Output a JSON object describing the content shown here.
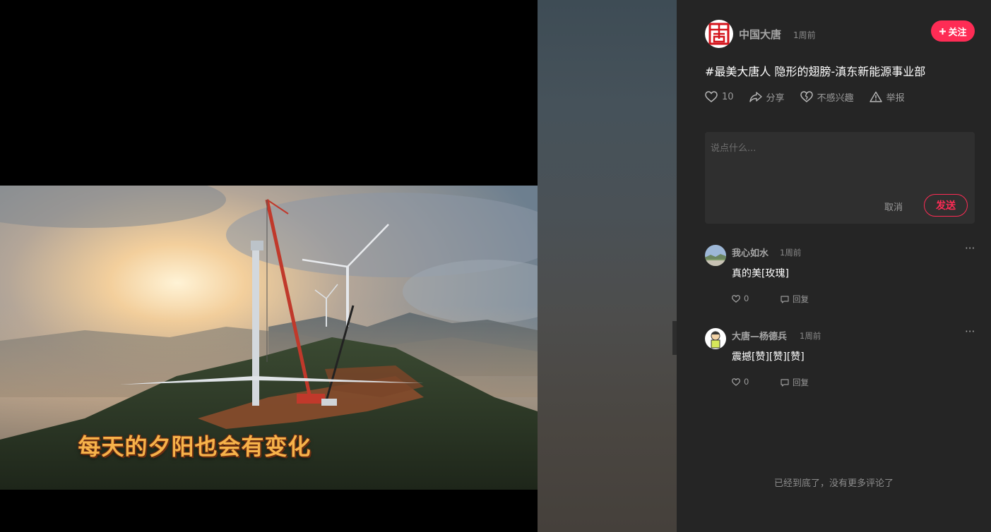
{
  "video": {
    "subtitle": "每天的夕阳也会有变化"
  },
  "author": {
    "name": "中国大唐",
    "time": "1周前",
    "avatar_icon": "datang-logo-icon",
    "follow_label": "关注"
  },
  "post": {
    "title": "#最美大唐人 隐形的翅膀-滇东新能源事业部"
  },
  "actions": {
    "like_count": "10",
    "share_label": "分享",
    "not_interested_label": "不感兴趣",
    "report_label": "举报"
  },
  "comment_box": {
    "placeholder": "说点什么...",
    "cancel_label": "取消",
    "send_label": "发送"
  },
  "comments": [
    {
      "user": "我心如水",
      "time": "1周前",
      "text": "真的美[玫瑰]",
      "likes": "0",
      "reply_label": "回复",
      "more_label": "···"
    },
    {
      "user": "大唐—杨德兵",
      "time": "1周前",
      "text": "震撼[赞][赞][赞]",
      "likes": "0",
      "reply_label": "回复",
      "more_label": "···"
    }
  ],
  "footer": {
    "end_text": "已经到底了，没有更多评论了"
  },
  "colors": {
    "accent": "#fe2c55",
    "panel_bg": "#252525",
    "subtitle": "#f6b24a"
  }
}
